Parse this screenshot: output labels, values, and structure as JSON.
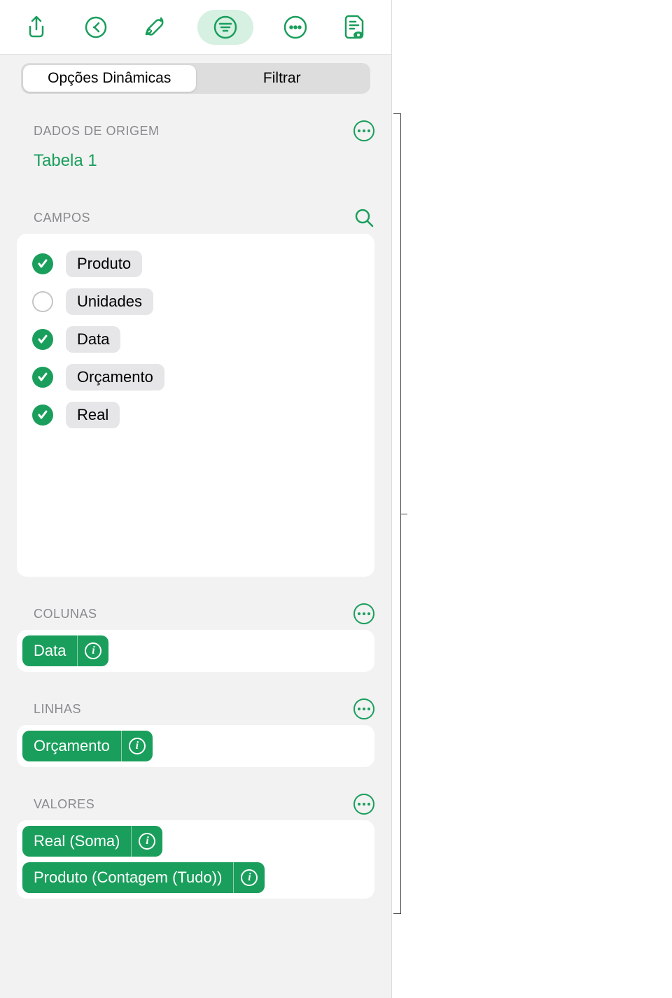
{
  "tabs": {
    "options": "Opções Dinâmicas",
    "filter": "Filtrar"
  },
  "sections": {
    "source": "DADOS DE ORIGEM",
    "fields": "CAMPOS",
    "columns": "COLUNAS",
    "rows": "LINHAS",
    "values": "VALORES"
  },
  "source_table": "Tabela 1",
  "fields": [
    {
      "label": "Produto",
      "checked": true
    },
    {
      "label": "Unidades",
      "checked": false
    },
    {
      "label": "Data",
      "checked": true
    },
    {
      "label": "Orçamento",
      "checked": true
    },
    {
      "label": "Real",
      "checked": true
    }
  ],
  "columns": [
    {
      "label": "Data"
    }
  ],
  "rows": [
    {
      "label": "Orçamento"
    }
  ],
  "values": [
    {
      "label": "Real (Soma)"
    },
    {
      "label": "Produto (Contagem (Tudo))"
    }
  ],
  "colors": {
    "accent": "#1a9e5c"
  }
}
